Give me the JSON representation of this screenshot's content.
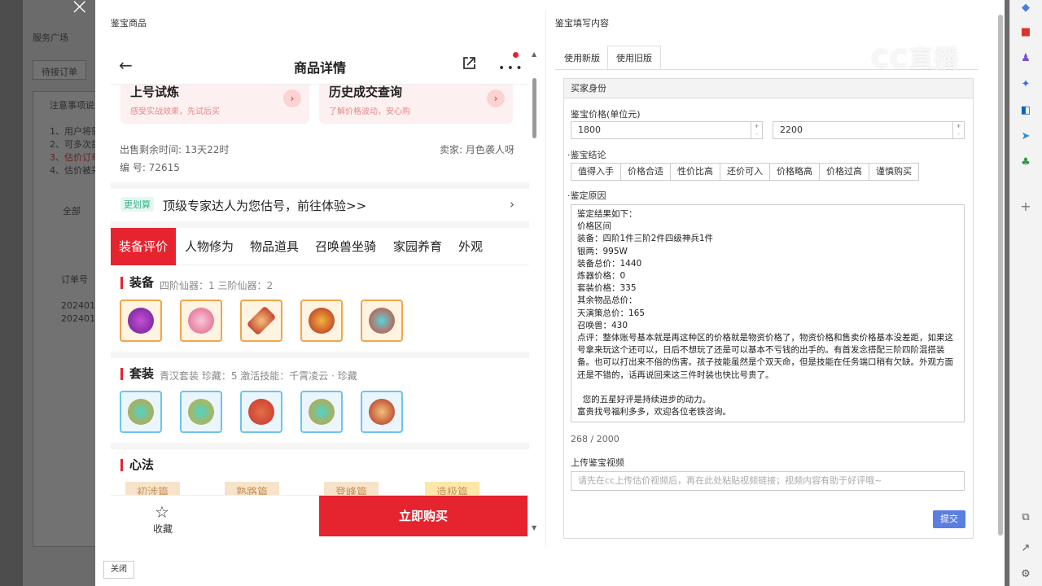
{
  "background": {
    "left_labels": [
      "服务广场",
      "待接订单"
    ],
    "notice_title": "注意事项说",
    "notice_lines": [
      "1、用户将需",
      "2、可多次提",
      "3、估价订单",
      "4、估价被采"
    ],
    "filter_all": "全部",
    "table_header": "订单号",
    "rows": [
      "2024010",
      "2024010"
    ]
  },
  "modal": {
    "left_title": "鉴宝商品",
    "right_title": "鉴宝填写内容",
    "close_label": "关闭"
  },
  "phone": {
    "title": "商品详情",
    "cards": [
      {
        "title": "上号试炼",
        "subtitle": "感受实战效果，先试后买"
      },
      {
        "title": "历史成交查询",
        "subtitle": "了解价格波动，安心购"
      }
    ],
    "sale_time": "出售剩余时间: 13天22时",
    "seller": "卖家: 月色袭人呀",
    "serial": "编 号: 72615",
    "promo_tag": "更划算",
    "promo_text": "顶级专家达人为您估号，前往体验>>",
    "tabs": [
      "装备评价",
      "人物修为",
      "物品道具",
      "召唤兽坐骑",
      "家园养育",
      "外观"
    ],
    "equip_title": "装备",
    "equip_sub": "四阶仙器：1   三阶仙器：2",
    "suit_title": "套装",
    "suit_sub": "青汉套装   珍藏：5   激活技能：千霄凌云 · 珍藏",
    "xinfa_title": "心法",
    "xinfa_items": [
      "初涉篇",
      "熟路篇",
      "登峰篇",
      "造极篇"
    ],
    "fav_label": "收藏",
    "buy_label": "立即购买"
  },
  "form": {
    "tabs": [
      "使用新版",
      "使用旧版"
    ],
    "active_tab": "使用旧版",
    "section_header": "买家身份",
    "price_label": "鉴宝价格(单位元)",
    "price_min": "1800",
    "price_max": "2200",
    "conclusion_label": "·鉴宝结论",
    "conclusions": [
      "值得入手",
      "价格合适",
      "性价比高",
      "还价可入",
      "价格略高",
      "价格过高",
      "谨慎购买"
    ],
    "reason_label": "·鉴定原因",
    "reason_text": "鉴定结果如下：\n价格区间\n装备：四阶1件三阶2件四级神兵1件\n银两：995W\n装备总价：1440\n炼器价格：0\n套装价格：335\n其余物品总价：\n天演策总价：165\n召唤兽：430\n点评：整体账号基本就是再这种区的价格就是物资价格了，物资价格和售卖价格基本没差距，如果这号拿来玩这个还可以，日后不想玩了还是可以基本不亏钱的出手的。有首发念搭配三阶四阶混搭装备。也可以打出来不俗的伤害。孩子技能虽然是个双天命，但是技能在任务端口稍有欠缺。外观方面还是不错的，话再说回来这三件时装也快比号贵了。\n\n  您的五星好评是持续进步的动力。\n富贵找号福利多多，欢迎各位老铁咨询。",
    "counter": "268 / 2000",
    "video_label": "上传鉴宝视频",
    "video_placeholder": "请先在cc上传估价视频后，再在此处粘贴视频链接；视频内容有助于好评哦~",
    "submit_label": "提交"
  },
  "watermark": "CC直播",
  "colors": {
    "accent_red": "#e5242f",
    "submit_blue": "#5b7fe0"
  }
}
